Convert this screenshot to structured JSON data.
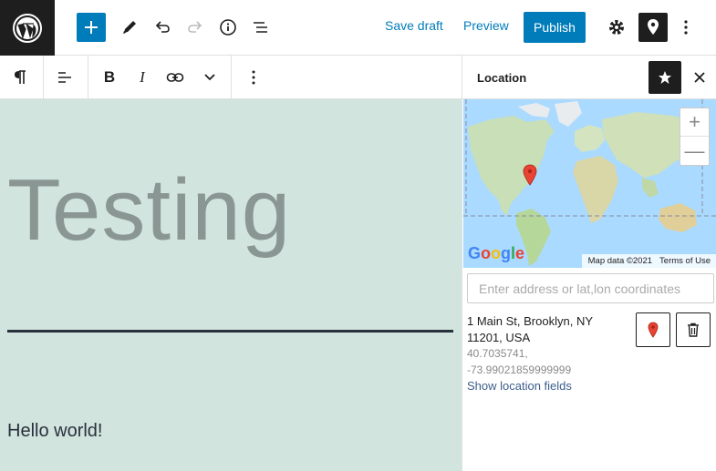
{
  "topbar": {
    "save_draft": "Save draft",
    "preview": "Preview",
    "publish": "Publish"
  },
  "content": {
    "heading": "Testing",
    "paragraph": "Hello world!"
  },
  "sidebar": {
    "title": "Location",
    "map": {
      "logo": "Google",
      "map_data": "Map data ©2021",
      "terms": "Terms of Use",
      "zoom_in": "+",
      "zoom_out": "—"
    },
    "search_placeholder": "Enter address or lat,lon coordinates",
    "address_line1": "1 Main St, Brooklyn, NY",
    "address_line2": "11201, USA",
    "lat": "40.7035741,",
    "lon": "-73.99021859999999",
    "show_fields": "Show location fields"
  },
  "colors": {
    "accent": "#007cba",
    "dark": "#1e1e1e",
    "content_bg": "#d1e4dd",
    "map_water": "#aadaff"
  }
}
